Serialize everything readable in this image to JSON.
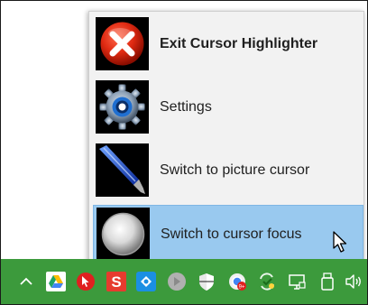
{
  "menu": {
    "items": [
      {
        "label": "Exit Cursor Highlighter",
        "icon": "close-icon",
        "bold": true,
        "selected": false
      },
      {
        "label": "Settings",
        "icon": "gear-icon",
        "bold": false,
        "selected": false
      },
      {
        "label": "Switch to picture cursor",
        "icon": "pen-icon",
        "bold": false,
        "selected": false
      },
      {
        "label": "Switch to cursor focus",
        "icon": "focus-circle-icon",
        "bold": false,
        "selected": true
      }
    ]
  },
  "taskbar": {
    "background": "#3c9a3c",
    "tray_icons": [
      "chevron-up-icon",
      "google-drive-icon",
      "cursor-app-icon",
      "s-app-icon",
      "teamviewer-icon",
      "gray-circle-icon",
      "shield-icon",
      "chrome-badge-icon",
      "sync-check-icon",
      "display-icon",
      "usb-drive-icon",
      "volume-icon"
    ]
  },
  "colors": {
    "menu_background": "#f2f2f2",
    "selected_item": "#99c9ef",
    "selected_border": "#7fb6e4"
  }
}
